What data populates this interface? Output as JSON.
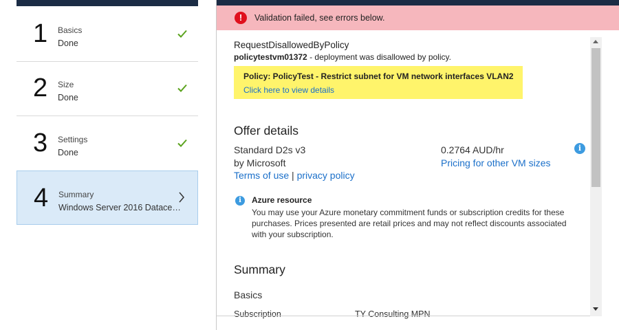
{
  "wizard": {
    "steps": [
      {
        "number": "1",
        "title": "Basics",
        "status": "Done"
      },
      {
        "number": "2",
        "title": "Size",
        "status": "Done"
      },
      {
        "number": "3",
        "title": "Settings",
        "status": "Done"
      },
      {
        "number": "4",
        "title": "Summary",
        "status": "Windows Server 2016 Datacen..."
      }
    ]
  },
  "banner": {
    "icon": "!",
    "text": "Validation failed, see errors below."
  },
  "error": {
    "title": "RequestDisallowedByPolicy",
    "vm_name": "policytestvm01372",
    "message": " - deployment was disallowed by policy.",
    "policy_name": "Policy: PolicyTest - Restrict subnet for VM network interfaces VLAN2",
    "policy_link": "Click here to view details"
  },
  "offer": {
    "heading": "Offer details",
    "size": "Standard D2s v3",
    "publisher": "by Microsoft",
    "terms_link": "Terms of use",
    "separator": "|",
    "privacy_link": "privacy policy",
    "price": "0.2764 AUD/hr",
    "pricing_link": "Pricing for other VM sizes",
    "info_icon": "i"
  },
  "azure_resource": {
    "title": "Azure resource",
    "body": "You may use your Azure monetary commitment funds or subscription credits for these purchases. Prices presented are retail prices and may not reflect discounts associated with your subscription.",
    "info_icon": "i"
  },
  "summary": {
    "heading": "Summary",
    "section": "Basics",
    "subscription_label": "Subscription",
    "subscription_value": "TY Consulting MPN"
  },
  "colors": {
    "accent_link": "#1a6fc9",
    "error_banner": "#f6b7bd",
    "error_icon": "#e0101d",
    "policy_highlight": "#fff46b",
    "selected_step": "#daeaf8",
    "check_green": "#5ba31e"
  }
}
